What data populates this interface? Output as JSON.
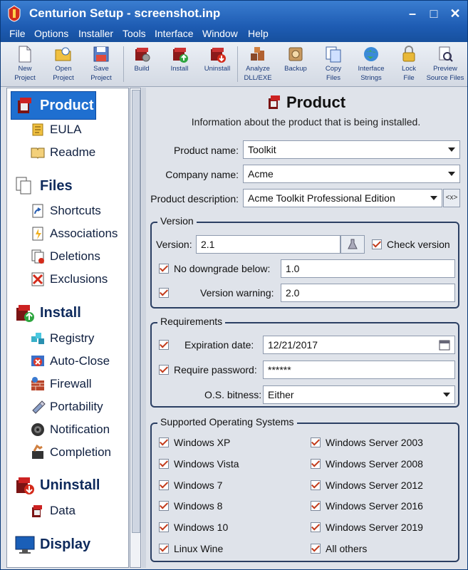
{
  "window": {
    "title": "Centurion Setup - screenshot.inp",
    "minimize": "–",
    "maximize": "□",
    "close": "✕"
  },
  "menu": [
    "File",
    "Options",
    "Installer",
    "Tools",
    "Interface",
    "Window",
    "Help"
  ],
  "toolbar": [
    {
      "label1": "New",
      "label2": "Project",
      "icon": "new-project-icon"
    },
    {
      "label1": "Open",
      "label2": "Project",
      "icon": "open-project-icon"
    },
    {
      "label1": "Save",
      "label2": "Project",
      "icon": "save-project-icon"
    },
    {
      "label1": "",
      "label2": "Build",
      "icon": "build-icon"
    },
    {
      "label1": "",
      "label2": "Install",
      "icon": "install-icon"
    },
    {
      "label1": "",
      "label2": "Uninstall",
      "icon": "uninstall-icon"
    },
    {
      "label1": "Analyze",
      "label2": "DLL/EXE",
      "icon": "analyze-icon"
    },
    {
      "label1": "",
      "label2": "Backup",
      "icon": "backup-icon"
    },
    {
      "label1": "Copy",
      "label2": "Files",
      "icon": "copy-files-icon"
    },
    {
      "label1": "Interface",
      "label2": "Strings",
      "icon": "globe-icon"
    },
    {
      "label1": "Lock",
      "label2": "File",
      "icon": "lock-icon"
    },
    {
      "label1": "Preview",
      "label2": "Source Files",
      "icon": "preview-icon"
    }
  ],
  "sidebar": {
    "product": "Product",
    "eula": "EULA",
    "readme": "Readme",
    "files": "Files",
    "shortcuts": "Shortcuts",
    "associations": "Associations",
    "deletions": "Deletions",
    "exclusions": "Exclusions",
    "install": "Install",
    "registry": "Registry",
    "autoclose": "Auto-Close",
    "firewall": "Firewall",
    "portability": "Portability",
    "notification": "Notification",
    "completion": "Completion",
    "uninstall": "Uninstall",
    "data": "Data",
    "display": "Display"
  },
  "main": {
    "title": "Product",
    "subtitle": "Information about the product that is being installed.",
    "product_name_label": "Product name:",
    "product_name": "Toolkit",
    "company_name_label": "Company name:",
    "company_name": "Acme",
    "product_desc_label": "Product description:",
    "product_desc": "Acme Toolkit Professional Edition",
    "desc_btn": "<x>",
    "version_group": "Version",
    "version_label": "Version:",
    "version": "2.1",
    "check_version": "Check version",
    "no_downgrade": "No downgrade below:",
    "no_downgrade_val": "1.0",
    "version_warning": "Version warning:",
    "version_warning_val": "2.0",
    "req_group": "Requirements",
    "expiration": "Expiration date:",
    "expiration_val": "12/21/2017",
    "require_pw": "Require password:",
    "require_pw_val": "******",
    "bitness_label": "O.S. bitness:",
    "bitness": "Either",
    "os_group": "Supported Operating Systems",
    "os_left": [
      "Windows XP",
      "Windows Vista",
      "Windows 7",
      "Windows 8",
      "Windows 10",
      "Linux Wine"
    ],
    "os_right": [
      "Windows Server 2003",
      "Windows Server 2008",
      "Windows Server 2012",
      "Windows Server 2016",
      "Windows Server 2019",
      "All others"
    ]
  }
}
